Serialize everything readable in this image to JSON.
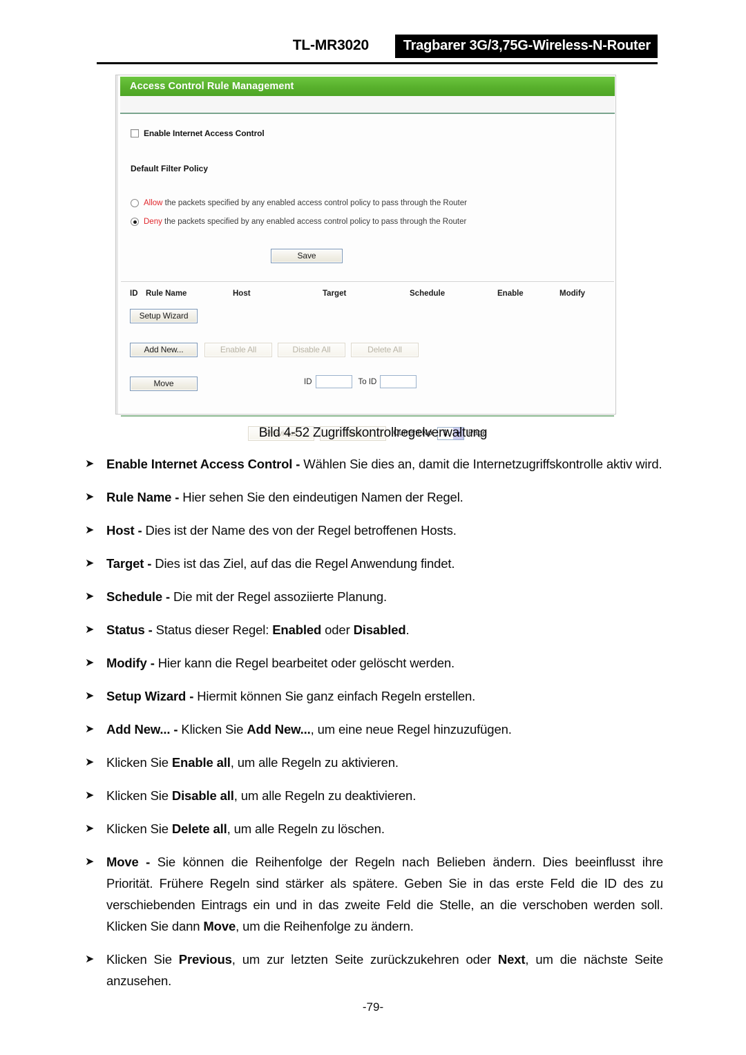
{
  "header": {
    "model": "TL-MR3020",
    "product": "Tragbarer 3G/3,75G-Wireless-N-Router"
  },
  "router_ui": {
    "title": "Access Control Rule Management",
    "enable_checkbox_label": "Enable Internet Access Control",
    "policy_heading": "Default Filter Policy",
    "policy_options": [
      {
        "keyword": "Allow",
        "text": " the packets specified by any enabled access control policy to pass through the Router",
        "selected": false
      },
      {
        "keyword": "Deny",
        "text": " the packets specified by any enabled access control policy to pass through the Router",
        "selected": true
      }
    ],
    "save_label": "Save",
    "table_headers": {
      "id": "ID",
      "rule_name": "Rule Name",
      "host": "Host",
      "target": "Target",
      "schedule": "Schedule",
      "enable": "Enable",
      "modify": "Modify"
    },
    "buttons": {
      "setup_wizard": "Setup Wizard",
      "add_new": "Add New...",
      "enable_all": "Enable All",
      "disable_all": "Disable All",
      "delete_all": "Delete All",
      "move": "Move",
      "previous": "Previous",
      "next": "Next"
    },
    "move_row": {
      "id_label": "ID",
      "id_value": "",
      "to_id_label": "To ID",
      "to_id_value": ""
    },
    "pagination": {
      "current_label": "Current No.",
      "page_value": "1",
      "page_suffix": "Page"
    },
    "colors": {
      "title_bar_green": "#58b02c",
      "policy_keyword_red": "#e0262b",
      "divider_green": "#8ab88f"
    }
  },
  "figure_caption": "Bild 4-52 Zugriffskontrollregelverwaltung",
  "bullets": [
    {
      "marker": "➤",
      "html": "<b>Enable Internet Access Control - </b>Wählen Sie dies an, damit die Internetzugriffskontrolle aktiv wird."
    },
    {
      "marker": "➤",
      "html": "<b>Rule Name - </b>Hier sehen Sie den eindeutigen Namen der Regel."
    },
    {
      "marker": "➤",
      "html": "<b>Host - </b>Dies ist der Name des von der Regel betroffenen Hosts."
    },
    {
      "marker": "➤",
      "html": "<b>Target - </b>Dies ist das Ziel, auf das die Regel Anwendung findet."
    },
    {
      "marker": "➤",
      "html": "<b>Schedule - </b>Die mit der Regel assoziierte Planung."
    },
    {
      "marker": "➤",
      "html": "<b>Status - </b>Status dieser Regel: <b>Enabled</b> oder <b>Disabled</b>."
    },
    {
      "marker": "➤",
      "html": "<b>Modify - </b>Hier kann die Regel bearbeitet oder gelöscht werden."
    },
    {
      "marker": "➤",
      "html": "<b>Setup Wizard - </b>Hiermit können Sie ganz einfach Regeln erstellen."
    },
    {
      "marker": "➤",
      "html": "<b>Add New... - </b>Klicken Sie <b>Add New...</b>, um eine neue Regel hinzuzufügen."
    },
    {
      "marker": "➤",
      "html": "Klicken Sie <b>Enable all</b>, um alle Regeln zu aktivieren."
    },
    {
      "marker": "➤",
      "html": "Klicken Sie <b>Disable all</b>, um alle Regeln zu deaktivieren."
    },
    {
      "marker": "➤",
      "html": "Klicken Sie <b>Delete all</b>, um alle Regeln zu löschen."
    },
    {
      "marker": "➤",
      "justify": true,
      "html": "<b>Move - </b>Sie können die Reihenfolge der Regeln nach Belieben ändern. Dies beeinflusst ihre Priorität. Frühere Regeln sind stärker als spätere. Geben Sie in das erste Feld die ID des zu verschiebenden Eintrags ein und in das zweite Feld die Stelle, an die verschoben werden soll. Klicken Sie dann <b>Move</b>, um die Reihenfolge zu ändern."
    },
    {
      "marker": "➤",
      "justify": true,
      "html": "Klicken Sie <b>Previous</b>, um zur letzten Seite zurückzukehren oder <b>Next</b>, um die nächste Seite anzusehen."
    }
  ],
  "footer": {
    "page_number": "-79-"
  }
}
